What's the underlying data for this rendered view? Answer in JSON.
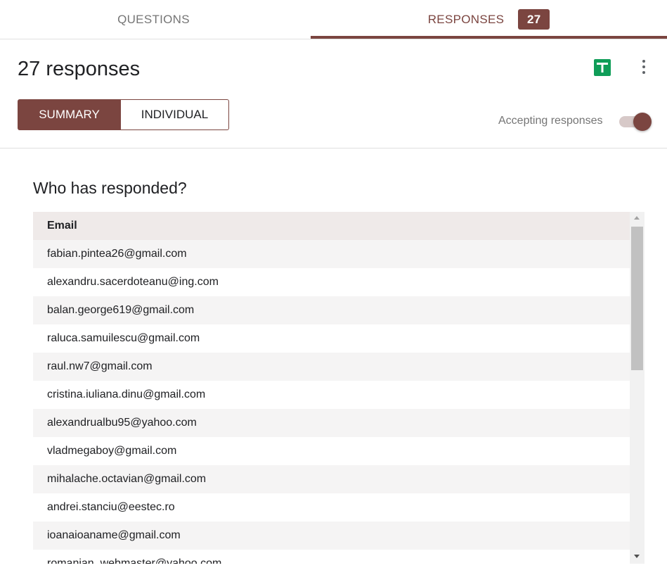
{
  "tabs": {
    "questions_label": "QUESTIONS",
    "responses_label": "RESPONSES",
    "responses_badge": "27"
  },
  "header": {
    "title": "27 responses",
    "sheets_icon": "google-sheets-icon",
    "more_icon": "more-vertical-icon",
    "view_summary_label": "SUMMARY",
    "view_individual_label": "INDIVIDUAL",
    "accepting_label": "Accepting responses",
    "accepting_on": true
  },
  "respondents": {
    "title": "Who has responded?",
    "column_header": "Email",
    "emails": [
      "fabian.pintea26@gmail.com",
      "alexandru.sacerdoteanu@ing.com",
      "balan.george619@gmail.com",
      "raluca.samuilescu@gmail.com",
      "raul.nw7@gmail.com",
      "cristina.iuliana.dinu@gmail.com",
      "alexandrualbu95@yahoo.com",
      "vladmegaboy@gmail.com",
      "mihalache.octavian@gmail.com",
      "andrei.stanciu@eestec.ro",
      "ioanaioaname@gmail.com",
      "romanian_webmaster@yahoo.com"
    ]
  },
  "colors": {
    "accent": "#7b4540",
    "sheets_green": "#0f9d58"
  }
}
